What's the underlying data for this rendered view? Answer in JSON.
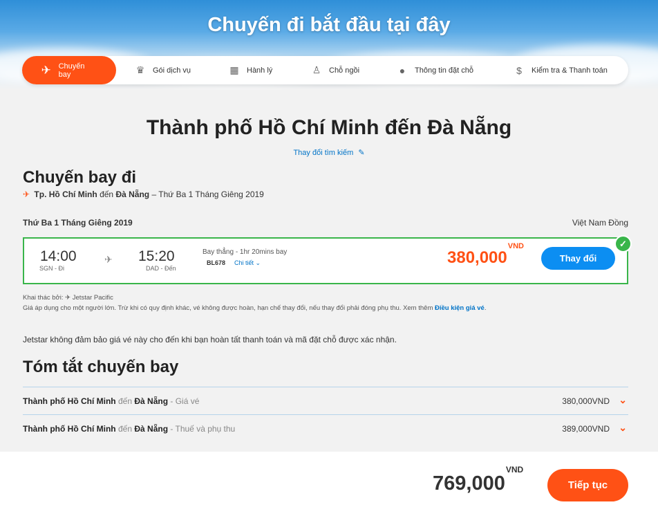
{
  "hero": {
    "title": "Chuyến đi bắt đầu tại đây"
  },
  "steps": [
    {
      "label": "Chuyến bay",
      "icon": "plane-icon"
    },
    {
      "label": "Gói dịch vụ",
      "icon": "bundle-icon"
    },
    {
      "label": "Hành lý",
      "icon": "luggage-icon"
    },
    {
      "label": "Chỗ ngồi",
      "icon": "seat-icon"
    },
    {
      "label": "Thông tin đặt chỗ",
      "icon": "person-icon"
    },
    {
      "label": "Kiểm tra & Thanh toán",
      "icon": "dollar-icon"
    }
  ],
  "main": {
    "heading": "Thành phố Hồ Chí Minh đến Đà Nẵng",
    "change_search": "Thay đổi tìm kiếm"
  },
  "outbound": {
    "title": "Chuyến bay đi",
    "origin": "Tp. Hồ Chí Minh",
    "to_word": "đến",
    "destination": "Đà Nẵng",
    "date_suffix": "– Thứ Ba 1 Tháng Giêng 2019",
    "date": "Thứ Ba 1 Tháng Giêng 2019",
    "currency": "Việt Nam Đồng"
  },
  "flight": {
    "depart_time": "14:00",
    "depart_label": "SGN - Đi",
    "arrive_time": "15:20",
    "arrive_label": "DAD - Đến",
    "duration": "Bay thẳng - 1hr 20mins bay",
    "flight_no": "BL678",
    "details": "Chi tiết",
    "price": "380,000",
    "price_unit": "VND",
    "change_button": "Thay đổi"
  },
  "info": {
    "operated_by": "Khai thác bởi:",
    "operator": "Jetstar Pacific",
    "fare_note": "Giá áp dụng cho một người lớn. Trừ khi có quy định khác, vé không được hoàn, hạn chế thay đổi, nếu thay đổi phải đóng phụ thu. Xem thêm",
    "fare_link": "Điều kiện giá vé",
    "guarantee": "Jetstar không đảm bảo giá vé này cho đến khi bạn hoàn tất thanh toán và mã đặt chỗ được xác nhận."
  },
  "summary": {
    "title": "Tóm tắt chuyến bay",
    "rows": [
      {
        "origin": "Thành phố Hồ Chí Minh",
        "to_word": "đến",
        "destination": "Đà Nẵng",
        "type": "- Giá vé",
        "amount": "380,000VND"
      },
      {
        "origin": "Thành phố Hồ Chí Minh",
        "to_word": "đến",
        "destination": "Đà Nẵng",
        "type": "- Thuế và phụ thu",
        "amount": "389,000VND"
      }
    ]
  },
  "footer": {
    "total": "769,000",
    "total_unit": "VND",
    "continue_button": "Tiếp tục"
  },
  "colors": {
    "accent": "#ff5115",
    "primary_blue": "#0c8ef2",
    "success": "#39b54a"
  }
}
